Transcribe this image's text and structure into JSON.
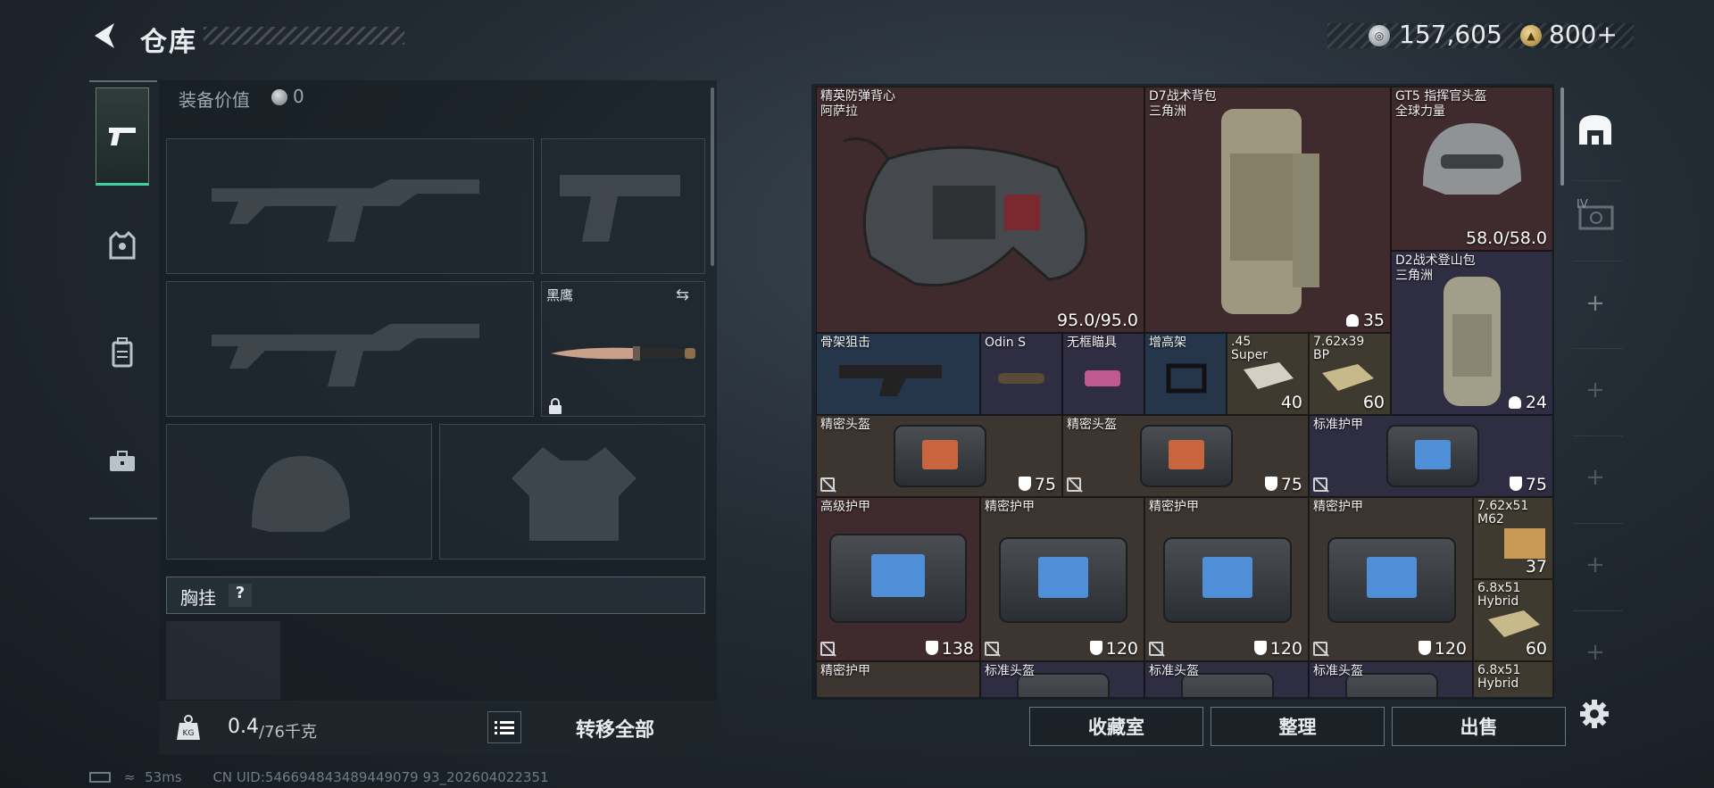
{
  "header": {
    "title": "仓库",
    "currency_silver": "157,605",
    "currency_gold": "800+"
  },
  "loadout": {
    "equipment_value_label": "装备价值",
    "equipment_value": "0",
    "knife_name": "黑鹰",
    "chest_rig_label": "胸挂",
    "chest_rig_help": "?",
    "weight_current": "0.4",
    "weight_max": "/76千克",
    "transfer_all_label": "转移全部"
  },
  "stash_items": [
    {
      "name": "精英防弹背心\n阿萨拉",
      "value": "95.0/95.0"
    },
    {
      "name": "D7战术背包\n三角洲",
      "value": "35"
    },
    {
      "name": "GT5 指挥官头盔\n全球力量",
      "value": "58.0/58.0"
    },
    {
      "name": "D2战术登山包\n三角洲",
      "value": "24"
    },
    {
      "name": "骨架狙击",
      "value": ""
    },
    {
      "name": "Odin S",
      "value": ""
    },
    {
      "name": "无框瞄具",
      "value": ""
    },
    {
      "name": "增高架",
      "value": ""
    },
    {
      "name": ".45\nSuper",
      "value": "40"
    },
    {
      "name": "7.62x39\nBP",
      "value": "60"
    },
    {
      "name": "精密头盔",
      "value": "75"
    },
    {
      "name": "精密头盔",
      "value": "75"
    },
    {
      "name": "标准护甲",
      "value": "75"
    },
    {
      "name": "高级护甲",
      "value": "138"
    },
    {
      "name": "精密护甲",
      "value": "120"
    },
    {
      "name": "精密护甲",
      "value": "120"
    },
    {
      "name": "精密护甲",
      "value": "120"
    },
    {
      "name": "7.62x51\nM62",
      "value": "37"
    },
    {
      "name": "6.8x51\nHybrid",
      "value": "60"
    },
    {
      "name": "精密护甲",
      "value": ""
    },
    {
      "name": "标准头盔",
      "value": ""
    },
    {
      "name": "标准头盔",
      "value": ""
    },
    {
      "name": "标准头盔",
      "value": ""
    },
    {
      "name": "6.8x51\nHybrid",
      "value": ""
    }
  ],
  "side_rail": {
    "tier_label": "IV"
  },
  "bottom_buttons": {
    "collection_room": "收藏室",
    "organize": "整理",
    "sell": "出售"
  },
  "status": {
    "ping": "53ms",
    "uid": "CN UID:546694843489449079 93_202604022351"
  },
  "colors": {
    "accent_green": "#3fd0a0",
    "rarity_red": "#3f2a2d",
    "rarity_purple": "#2f2d42",
    "rarity_blue": "#25354a",
    "rarity_gold": "#3f3a2f"
  }
}
